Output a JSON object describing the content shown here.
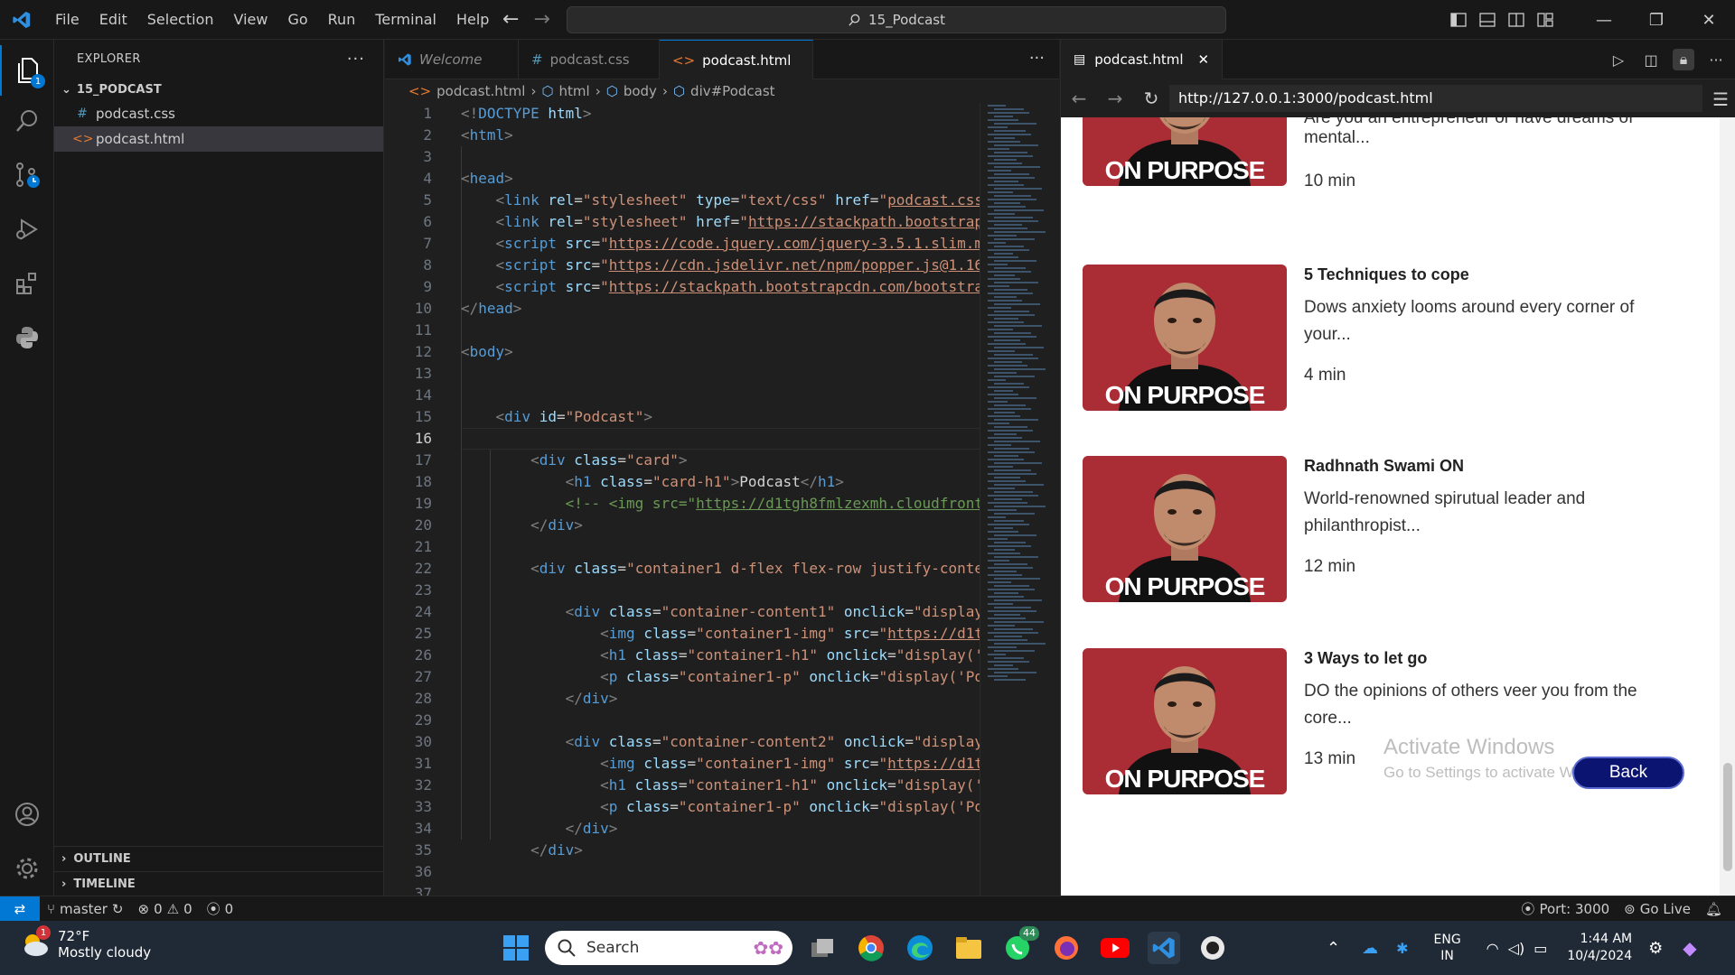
{
  "menu": [
    "File",
    "Edit",
    "Selection",
    "View",
    "Go",
    "Run",
    "Terminal",
    "Help"
  ],
  "command_center": "15_Podcast",
  "explorer": {
    "title": "EXPLORER",
    "folder": "15_PODCAST",
    "files": [
      "podcast.css",
      "podcast.html"
    ],
    "outline": "OUTLINE",
    "timeline": "TIMELINE",
    "badge": "1"
  },
  "tabs": [
    {
      "label": "Welcome"
    },
    {
      "label": "podcast.css"
    },
    {
      "label": "podcast.html"
    }
  ],
  "breadcrumb": [
    "podcast.html",
    "html",
    "body",
    "div#Podcast"
  ],
  "code_lines": [
    {
      "n": "1",
      "html": "<span class='t-punc'>&lt;!</span><span class='t-tag'>DOCTYPE</span> <span class='t-attr'>html</span><span class='t-punc'>&gt;</span>"
    },
    {
      "n": "2",
      "html": "<span class='t-punc'>&lt;</span><span class='t-tag'>html</span><span class='t-punc'>&gt;</span>"
    },
    {
      "n": "3",
      "html": ""
    },
    {
      "n": "4",
      "html": "<span class='t-punc'>&lt;</span><span class='t-tag'>head</span><span class='t-punc'>&gt;</span>"
    },
    {
      "n": "5",
      "html": "    <span class='t-punc'>&lt;</span><span class='t-tag'>link</span> <span class='t-attr'>rel</span>=<span class='t-str'>\"stylesheet\"</span> <span class='t-attr'>type</span>=<span class='t-str'>\"text/css\"</span> <span class='t-attr'>href</span>=<span class='t-str'>\"<u>podcast.css</u></span>"
    },
    {
      "n": "6",
      "html": "    <span class='t-punc'>&lt;</span><span class='t-tag'>link</span> <span class='t-attr'>rel</span>=<span class='t-str'>\"stylesheet\"</span> <span class='t-attr'>href</span>=<span class='t-str'>\"<u>https://stackpath.bootstrap</u></span>"
    },
    {
      "n": "7",
      "html": "    <span class='t-punc'>&lt;</span><span class='t-tag'>script</span> <span class='t-attr'>src</span>=<span class='t-str'>\"<u>https://code.jquery.com/jquery-3.5.1.slim.m</u></span>"
    },
    {
      "n": "8",
      "html": "    <span class='t-punc'>&lt;</span><span class='t-tag'>script</span> <span class='t-attr'>src</span>=<span class='t-str'>\"<u>https://cdn.jsdelivr.net/npm/popper.js@1.16</u></span>"
    },
    {
      "n": "9",
      "html": "    <span class='t-punc'>&lt;</span><span class='t-tag'>script</span> <span class='t-attr'>src</span>=<span class='t-str'>\"<u>https://stackpath.bootstrapcdn.com/bootstra</u></span>"
    },
    {
      "n": "10",
      "html": "<span class='t-punc'>&lt;/</span><span class='t-tag'>head</span><span class='t-punc'>&gt;</span>"
    },
    {
      "n": "11",
      "html": ""
    },
    {
      "n": "12",
      "html": "<span class='t-punc'>&lt;</span><span class='t-tag'>body</span><span class='t-punc'>&gt;</span>"
    },
    {
      "n": "13",
      "html": ""
    },
    {
      "n": "14",
      "html": ""
    },
    {
      "n": "15",
      "html": "    <span class='t-punc'>&lt;</span><span class='t-tag'>div</span> <span class='t-attr'>id</span>=<span class='t-str'>\"Podcast\"</span><span class='t-punc'>&gt;</span>"
    },
    {
      "n": "16",
      "html": ""
    },
    {
      "n": "17",
      "html": "        <span class='t-punc'>&lt;</span><span class='t-tag'>div</span> <span class='t-attr'>class</span>=<span class='t-str'>\"card\"</span><span class='t-punc'>&gt;</span>"
    },
    {
      "n": "18",
      "html": "            <span class='t-punc'>&lt;</span><span class='t-tag'>h1</span> <span class='t-attr'>class</span>=<span class='t-str'>\"card-h1\"</span><span class='t-punc'>&gt;</span><span class='t-txt'>Podcast</span><span class='t-punc'>&lt;/</span><span class='t-tag'>h1</span><span class='t-punc'>&gt;</span>"
    },
    {
      "n": "19",
      "html": "            <span class='t-com'>&lt;!-- &lt;img src=\"<u>https://d1tgh8fmlzexmh.cloudfront</u></span>"
    },
    {
      "n": "20",
      "html": "        <span class='t-punc'>&lt;/</span><span class='t-tag'>div</span><span class='t-punc'>&gt;</span>"
    },
    {
      "n": "21",
      "html": ""
    },
    {
      "n": "22",
      "html": "        <span class='t-punc'>&lt;</span><span class='t-tag'>div</span> <span class='t-attr'>class</span>=<span class='t-str'>\"container1 d-flex flex-row justify-conte</span>"
    },
    {
      "n": "23",
      "html": ""
    },
    {
      "n": "24",
      "html": "            <span class='t-punc'>&lt;</span><span class='t-tag'>div</span> <span class='t-attr'>class</span>=<span class='t-str'>\"container-content1\"</span> <span class='t-attr'>onclick</span>=<span class='t-str'>\"display</span>"
    },
    {
      "n": "25",
      "html": "                <span class='t-punc'>&lt;</span><span class='t-tag'>img</span> <span class='t-attr'>class</span>=<span class='t-str'>\"container1-img\"</span> <span class='t-attr'>src</span>=<span class='t-str'>\"<u>https://d1t</u></span>"
    },
    {
      "n": "26",
      "html": "                <span class='t-punc'>&lt;</span><span class='t-tag'>h1</span> <span class='t-attr'>class</span>=<span class='t-str'>\"container1-h1\"</span> <span class='t-attr'>onclick</span>=<span class='t-str'>\"display('</span>"
    },
    {
      "n": "27",
      "html": "                <span class='t-punc'>&lt;</span><span class='t-tag'>p</span> <span class='t-attr'>class</span>=<span class='t-str'>\"container1-p\"</span> <span class='t-attr'>onclick</span>=<span class='t-str'>\"display('Po</span>"
    },
    {
      "n": "28",
      "html": "            <span class='t-punc'>&lt;/</span><span class='t-tag'>div</span><span class='t-punc'>&gt;</span>"
    },
    {
      "n": "29",
      "html": ""
    },
    {
      "n": "30",
      "html": "            <span class='t-punc'>&lt;</span><span class='t-tag'>div</span> <span class='t-attr'>class</span>=<span class='t-str'>\"container-content2\"</span> <span class='t-attr'>onclick</span>=<span class='t-str'>\"display</span>"
    },
    {
      "n": "31",
      "html": "                <span class='t-punc'>&lt;</span><span class='t-tag'>img</span> <span class='t-attr'>class</span>=<span class='t-str'>\"container1-img\"</span> <span class='t-attr'>src</span>=<span class='t-str'>\"<u>https://d1t</u></span>"
    },
    {
      "n": "32",
      "html": "                <span class='t-punc'>&lt;</span><span class='t-tag'>h1</span> <span class='t-attr'>class</span>=<span class='t-str'>\"container1-h1\"</span> <span class='t-attr'>onclick</span>=<span class='t-str'>\"display('</span>"
    },
    {
      "n": "33",
      "html": "                <span class='t-punc'>&lt;</span><span class='t-tag'>p</span> <span class='t-attr'>class</span>=<span class='t-str'>\"container1-p\"</span> <span class='t-attr'>onclick</span>=<span class='t-str'>\"display('Po</span>"
    },
    {
      "n": "34",
      "html": "            <span class='t-punc'>&lt;/</span><span class='t-tag'>div</span><span class='t-punc'>&gt;</span>"
    },
    {
      "n": "35",
      "html": "        <span class='t-punc'>&lt;/</span><span class='t-tag'>div</span><span class='t-punc'>&gt;</span>"
    },
    {
      "n": "36",
      "html": ""
    },
    {
      "n": "37",
      "html": ""
    }
  ],
  "preview": {
    "tab_label": "podcast.html",
    "url": "http://127.0.0.1:3000/podcast.html",
    "thumb_text": "ON PURPOSE",
    "partial_episode": {
      "desc_top": "Are you an entrepreneur or have dreams of",
      "desc": "mental...",
      "duration": "10 min"
    },
    "episodes": [
      {
        "title": "5 Techniques to cope",
        "desc": "Dows anxiety looms around every corner of your...",
        "duration": "4 min"
      },
      {
        "title": "Radhnath Swami ON",
        "desc": "World-renowned spirutual leader and philanthropist...",
        "duration": "12 min"
      },
      {
        "title": "3 Ways to let go",
        "desc": "DO the opinions of others veer you from the core...",
        "duration": "13 min"
      }
    ],
    "activate_title": "Activate Windows",
    "activate_sub": "Go to Settings to activate Windows.",
    "back_label": "Back"
  },
  "status": {
    "branch": "master",
    "errors": "0",
    "warnings": "0",
    "ports": "0",
    "port": "Port: 3000",
    "golive": "Go Live"
  },
  "taskbar": {
    "temp": "72°F",
    "condition": "Mostly cloudy",
    "weather_badge": "1",
    "search": "Search",
    "whatsapp_badge": "44",
    "lang1": "ENG",
    "lang2": "IN",
    "time": "1:44 AM",
    "date": "10/4/2024"
  }
}
